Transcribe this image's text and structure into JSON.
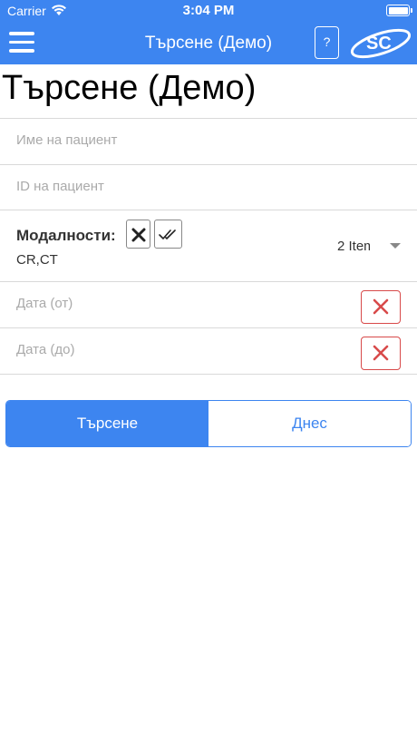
{
  "status_bar": {
    "carrier": "Carrier",
    "time": "3:04 PM"
  },
  "nav": {
    "title": "Търсене (Демо)",
    "help_label": "?",
    "logo_text": "SC"
  },
  "page": {
    "title": "Търсене (Демо)"
  },
  "fields": {
    "patient_name_placeholder": "Име на пациент",
    "patient_id_placeholder": "ID на пациент"
  },
  "modalities": {
    "label": "Модалности:",
    "value": "CR,CT",
    "selected_count": "2 Items"
  },
  "dates": {
    "from_label": "Дата (от)",
    "to_label": "Дата (до)"
  },
  "actions": {
    "search_label": "Търсене",
    "today_label": "Днес"
  },
  "colors": {
    "accent": "#3d85f0",
    "danger": "#d84a4a"
  }
}
